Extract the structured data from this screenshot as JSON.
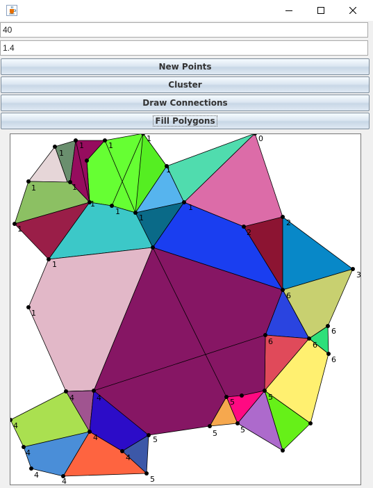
{
  "window": {
    "icon": "java-cup-icon",
    "controls": [
      "minimize-icon",
      "maximize-icon",
      "close-icon"
    ]
  },
  "inputs": {
    "points_count": "40",
    "threshold": "1.4"
  },
  "buttons": {
    "new_points": "New Points",
    "cluster": "Cluster",
    "draw_connections": "Draw Connections",
    "fill_polygons": "Fill Polygons"
  },
  "canvas": {
    "point_labels": [
      "1",
      "1",
      "1",
      "1",
      "1",
      "1",
      "1",
      "1",
      "1",
      "1",
      "1",
      "1",
      "1",
      "1",
      "0",
      "2",
      "2",
      "3",
      "6",
      "6",
      "6",
      "6",
      "6",
      "4",
      "4",
      "4",
      "4",
      "4",
      "4",
      "4",
      "4",
      "5",
      "5",
      "5",
      "5",
      "5",
      "5"
    ]
  },
  "colors": {
    "edge": "#000000",
    "point": "#000000",
    "background": "#ffffff"
  }
}
